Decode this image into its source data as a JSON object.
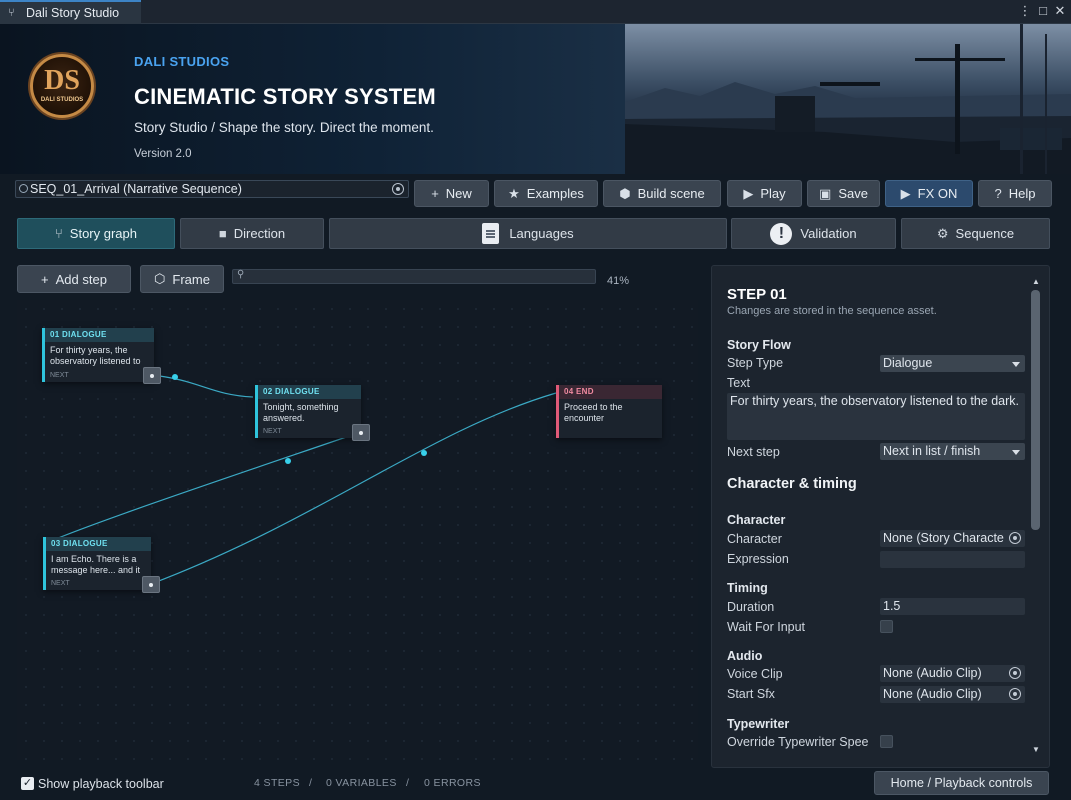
{
  "window": {
    "title": "Dali Story Studio"
  },
  "header": {
    "logo_text": "DS",
    "logo_caption": "DALI STUDIOS",
    "studio": "DALI STUDIOS",
    "title": "CINEMATIC STORY SYSTEM",
    "tagline": "Story Studio / Shape the story. Direct the moment.",
    "version": "Version 2.0"
  },
  "toolbar": {
    "sequence_field": "SEQ_01_Arrival (Narrative Sequence)",
    "new": "New",
    "examples": "Examples",
    "build_scene": "Build scene",
    "play": "Play",
    "save": "Save",
    "fx": "FX ON",
    "help": "Help"
  },
  "tabs": {
    "story_graph": "Story graph",
    "direction": "Direction",
    "languages": "Languages",
    "validation": "Validation",
    "sequence": "Sequence"
  },
  "graph_toolbar": {
    "add_step": "Add step",
    "frame": "Frame",
    "zoom": "41%"
  },
  "nodes": [
    {
      "header": "01  DIALOGUE",
      "text": "For thirty years, the observatory listened to the dark.",
      "next": "NEXT"
    },
    {
      "header": "02  DIALOGUE",
      "text": "Tonight, something answered.",
      "next": "NEXT"
    },
    {
      "header": "03  DIALOGUE",
      "text": "I am Echo. There is a message here... and it",
      "next": "NEXT"
    },
    {
      "header": "04  END",
      "text": "Proceed to the encounter"
    }
  ],
  "inspector": {
    "step_title": "STEP 01",
    "note": "Changes are stored in the sequence asset.",
    "story_flow": "Story Flow",
    "step_type_label": "Step Type",
    "step_type_value": "Dialogue",
    "text_label": "Text",
    "text_value": "For thirty years, the observatory listened to the dark.",
    "next_step_label": "Next step",
    "next_step_value": "Next in list / finish",
    "char_timing": "Character & timing",
    "character_head": "Character",
    "character_label": "Character",
    "character_value": "None (Story Characte",
    "expression_label": "Expression",
    "timing_head": "Timing",
    "duration_label": "Duration",
    "duration_value": "1.5",
    "wait_label": "Wait For Input",
    "audio_head": "Audio",
    "voice_label": "Voice Clip",
    "voice_value": "None (Audio Clip)",
    "sfx_label": "Start Sfx",
    "sfx_value": "None (Audio Clip)",
    "typewriter_head": "Typewriter",
    "override_label": "Override Typewriter Spee"
  },
  "footer": {
    "show_toolbar": "Show playback toolbar",
    "steps": "4 STEPS",
    "sep": "/",
    "variables": "0 VARIABLES",
    "errors": "0 ERRORS",
    "home": "Home / Playback controls"
  }
}
